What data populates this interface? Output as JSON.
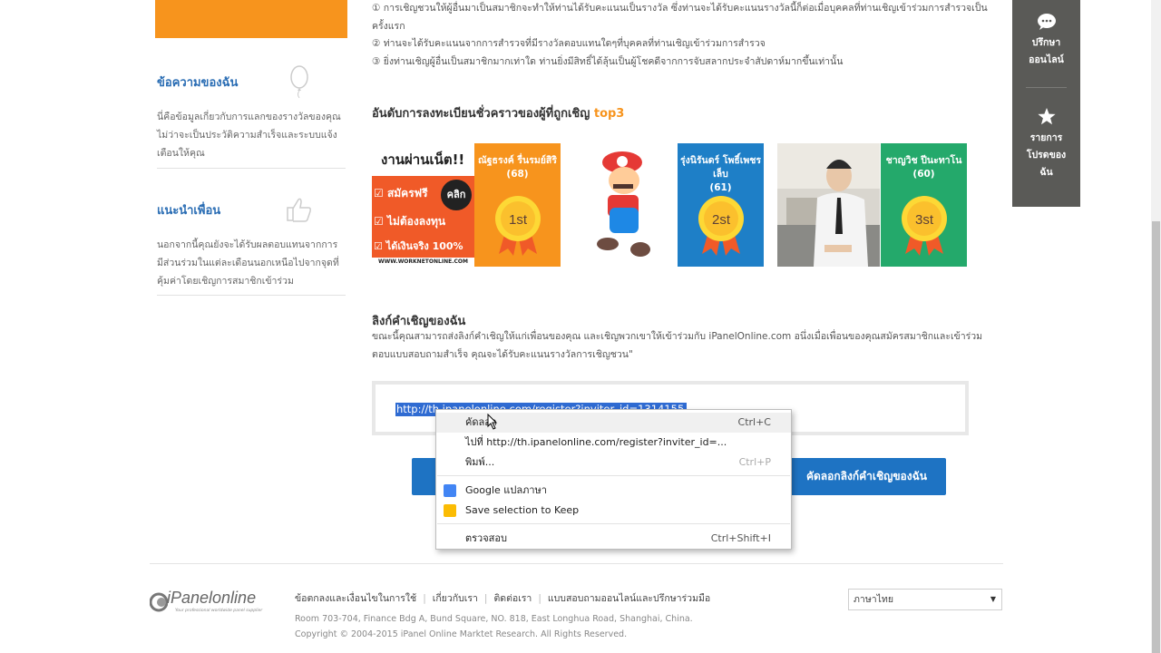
{
  "sidebar": {
    "my_messages_title": "ข้อความของฉัน",
    "my_messages_text": [
      "นี่คือข้อมูลเกี่ยวกับการแลกของรางวัลของคุณ",
      "ไม่ว่าจะเป็นประวัติความสำเร็จและระบบแจ้ง",
      "เตือนให้คุณ"
    ],
    "recommend_title": "แนะนำเพื่อน",
    "recommend_text": [
      "นอกจากนี้คุณยังจะได้รับผลตอบแทนจากการ",
      "มีส่วนร่วมในแต่ละเดือนนอกเหนือไปจากจุดที่",
      "คุ้มค่าโดยเชิญการสมาชิกเข้าร่วม"
    ]
  },
  "rules": {
    "line1": "① การเชิญชวนให้ผู้อื่นมาเป็นสมาชิกจะทำให้ท่านได้รับคะแนนเป็นรางวัล ซึ่งท่านจะได้รับคะแนนรางวัลนี้ก็ต่อเมื่อบุคคลที่ท่านเชิญเข้าร่วมการสำรวจเป็น",
    "line1b": "ครั้งแรก",
    "line2": "② ท่านจะได้รับคะแนนจากการสำรวจที่มีรางวัลตอบแทนใดๆที่บุคคลที่ท่านเชิญเข้าร่วมการสำรวจ",
    "line3": "③ ยิ่งท่านเชิญผู้อื่นเป็นสมาชิกมากเท่าใด ท่านยิ่งมีสิทธิ์ได้ลุ้นเป็นผู้โชคดีจากการจับสลากประจำสัปดาห์มากขึ้นเท่านั้น"
  },
  "ranking": {
    "title": "อันดับการลงทะเบียนชั่วคราวของผู้ที่ถูกเชิญ",
    "title_highlight": "top3",
    "ad": {
      "line1": "งานผ่านเน็ต!!",
      "item1": "สมัครฟรี",
      "item2": "ไม่ต้องลงทุน",
      "item3": "ได้เงินจริง 100%",
      "click": "คลิก",
      "url": "WWW.WORKNETONLINE.COM"
    },
    "entries": [
      {
        "name": "ณัฐธรงค์ รื่นรมย์สิริ",
        "count": "(68)",
        "rank": "1st"
      },
      {
        "name": "รุ่งนิรันดร์ โพธิ์เพชรเล็บ",
        "count": "(61)",
        "rank": "2st"
      },
      {
        "name": "ชาญวิช ปีนะทาโน",
        "count": "(60)",
        "rank": "3st"
      }
    ]
  },
  "invite": {
    "title": "ลิงก์คำเชิญของฉัน",
    "desc1": "ขณะนี้คุณสามารถส่งลิงก์คำเชิญให้แก่เพื่อนของคุณ และเชิญพวกเขาให้เข้าร่วมกับ iPanelOnline.com  อนึ่งเมื่อเพื่อนของคุณสมัครสมาชิกและเข้าร่วม",
    "desc2": "ตอบแบบสอบถามสำเร็จ คุณจะได้รับคะแนนรางวัลการเชิญชวน\"",
    "link": "http://th.ipanelonline.com/register?inviter_id=1314155",
    "copy_button": "คัดลอกลิงก์คำเชิญของฉัน"
  },
  "context_menu": {
    "copy": "คัดลอก",
    "copy_shortcut": "Ctrl+C",
    "goto": "ไปที่ http://th.ipanelonline.com/register?inviter_id=...",
    "print": "พิมพ์...",
    "print_shortcut": "Ctrl+P",
    "google_translate": "Google แปลภาษา",
    "save_keep": "Save selection to Keep",
    "inspect": "ตรวจสอบ",
    "inspect_shortcut": "Ctrl+Shift+I"
  },
  "float_bar": {
    "consult": [
      "ปรึกษา",
      "ออนไลน์"
    ],
    "favorites": [
      "รายการ",
      "โปรดของ",
      "ฉัน"
    ]
  },
  "footer": {
    "logo": "iPanelonline",
    "logo_sub": "Your professional worldwide panel supplier",
    "links": [
      "ข้อตกลงและเงื่อนไขในการใช้",
      "เกี่ยวกับเรา",
      "ติดต่อเรา",
      "แบบสอบถามออนไลน์และปรึกษาร่วมมือ"
    ],
    "address": "Room 703-704, Finance Bdg A, Bund Square, NO. 818, East Longhua Road, Shanghai, China.",
    "copyright": "Copyright © 2004-2015 iPanel Online Marktet Research. All Rights Reserved.",
    "language": "ภาษาไทย"
  },
  "colors": {
    "accent_orange": "#f7941d",
    "link_blue": "#2a6db4",
    "button_blue": "#1e73c3",
    "tile_blue": "#1e7fc7",
    "tile_green": "#24a96b",
    "float_bar": "#5a5a57"
  }
}
